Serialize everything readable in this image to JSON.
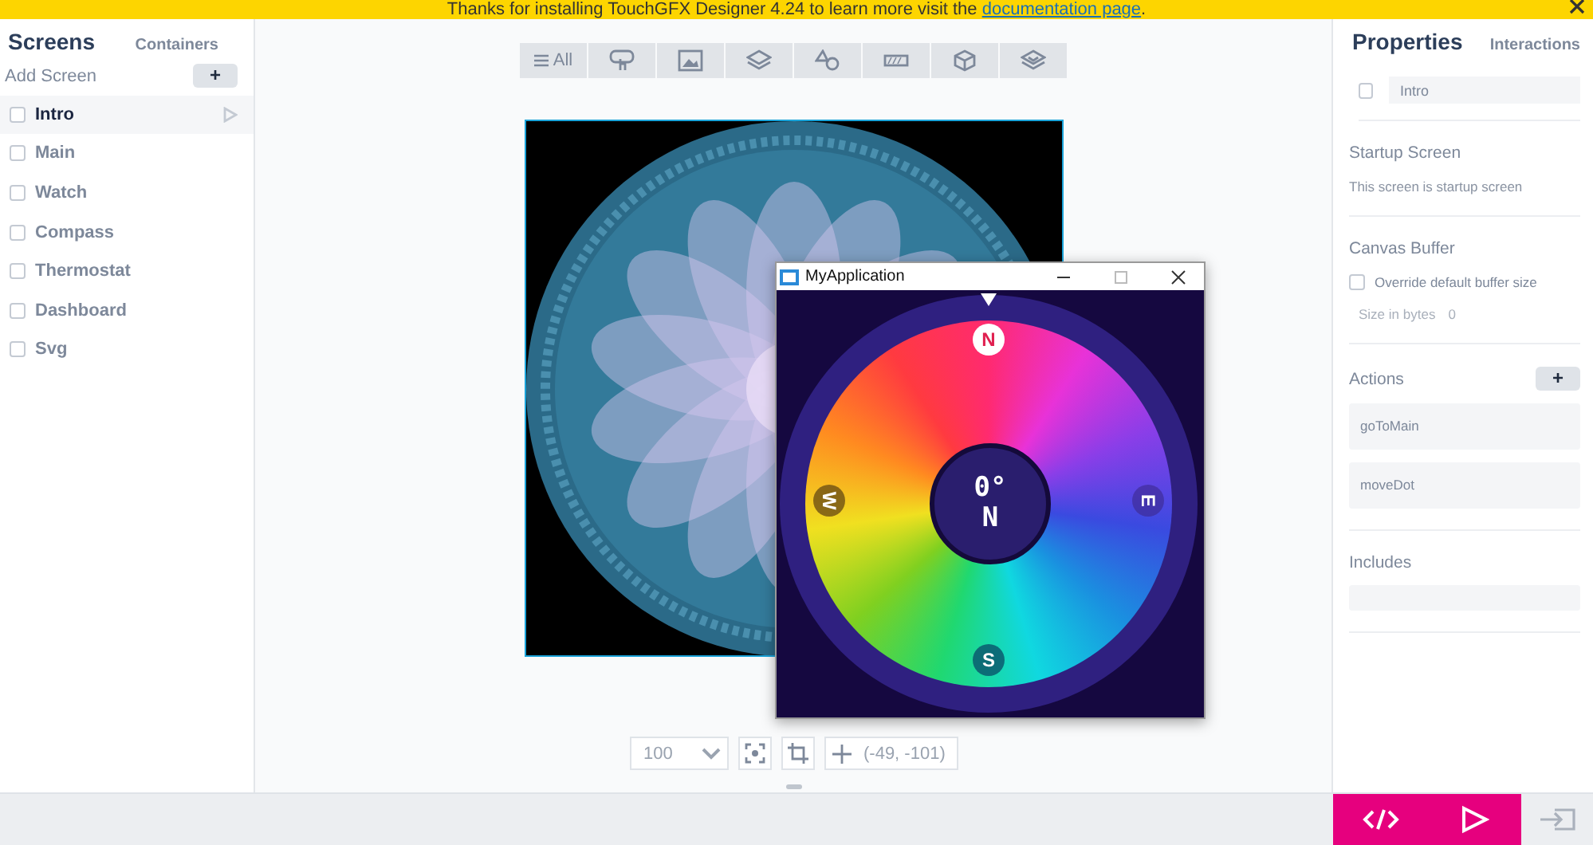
{
  "banner": {
    "text": "Thanks for installing TouchGFX Designer 4.24 to learn more visit the",
    "link": "documentation page",
    "tail": "."
  },
  "sidebar": {
    "tabs": [
      {
        "label": "Screens",
        "selected": true
      },
      {
        "label": "Containers",
        "selected": false
      }
    ],
    "add_label": "Add Screen",
    "add_button": "+",
    "screens": [
      {
        "name": "Intro",
        "selected": true,
        "checked": false
      },
      {
        "name": "Main",
        "selected": false,
        "checked": false
      },
      {
        "name": "Watch",
        "selected": false,
        "checked": false
      },
      {
        "name": "Compass",
        "selected": false,
        "checked": false
      },
      {
        "name": "Thermostat",
        "selected": false,
        "checked": false
      },
      {
        "name": "Dashboard",
        "selected": false,
        "checked": false
      },
      {
        "name": "Svg",
        "selected": false,
        "checked": false
      }
    ]
  },
  "toolbar": {
    "all_label": "All"
  },
  "app_window": {
    "title": "MyApplication",
    "heading": "0°",
    "direction": "N",
    "markers": [
      "N",
      "E",
      "S",
      "W"
    ]
  },
  "zoom": {
    "value": "100",
    "coords": "(-49, -101)"
  },
  "properties": {
    "tabs": [
      {
        "label": "Properties",
        "selected": true
      },
      {
        "label": "Interactions",
        "selected": false
      }
    ],
    "name": "Intro",
    "name_checked": false,
    "startup": {
      "title": "Startup Screen",
      "text": "This screen is startup screen"
    },
    "canvas_buffer": {
      "title": "Canvas Buffer",
      "option": "Override default buffer size",
      "checked": false,
      "size_label": "Size in bytes",
      "size_value": "0",
      "disabled": true
    },
    "actions": {
      "title": "Actions",
      "add_button": "+",
      "items": [
        "goToMain",
        "moveDot"
      ]
    },
    "includes": {
      "title": "Includes"
    }
  }
}
